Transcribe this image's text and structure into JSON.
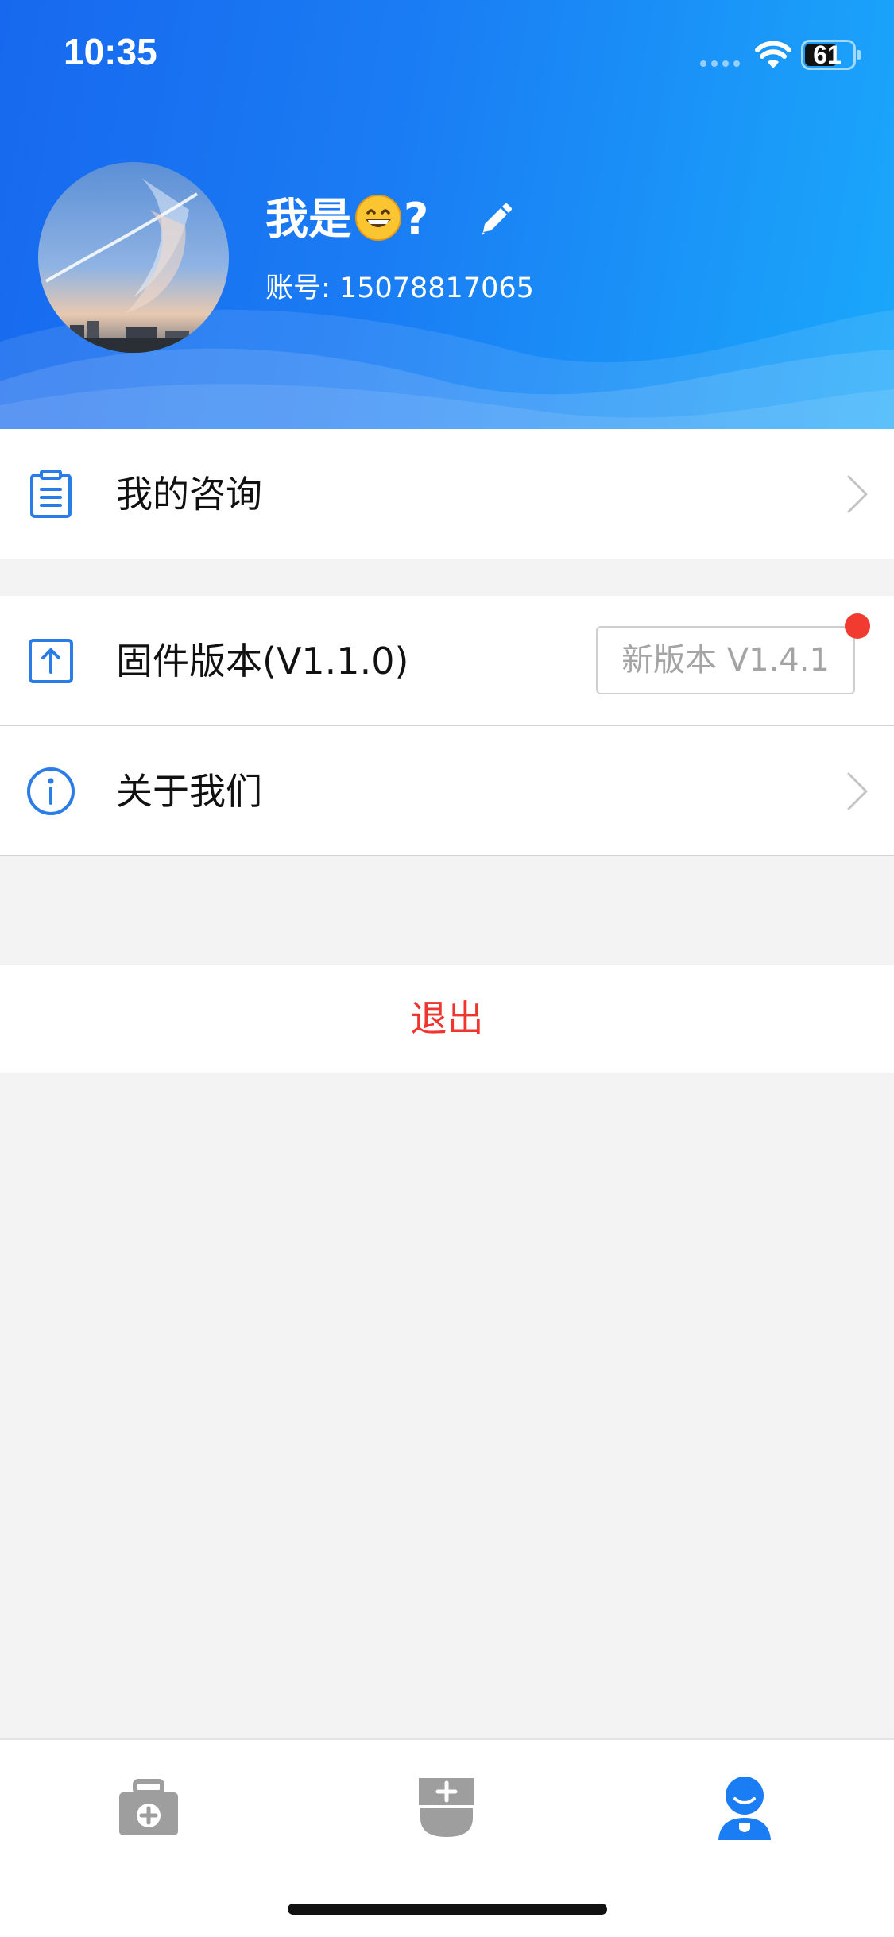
{
  "status_bar": {
    "time": "10:35",
    "battery_level": "61"
  },
  "profile": {
    "name_prefix": "我是",
    "name_emoji": "grinning-face-icon",
    "name_suffix": "?",
    "account_label": "账号:",
    "account_number": "15078817065"
  },
  "menu": {
    "consult_label": "我的咨询",
    "firmware_label": "固件版本(V1.1.0)",
    "update_button_label": "新版本 V1.4.1",
    "about_label": "关于我们"
  },
  "logout_label": "退出",
  "tab_bar": {
    "tabs": [
      "medical-kit-icon",
      "device-add-icon",
      "user-profile-icon"
    ],
    "active_index": 2
  },
  "colors": {
    "accent": "#1a7df4",
    "header_start": "#1768ee",
    "header_end": "#1aa8fb",
    "logout_red": "#ee3530",
    "notification_dot": "#f23b30",
    "tab_inactive": "#9e9e9e"
  }
}
